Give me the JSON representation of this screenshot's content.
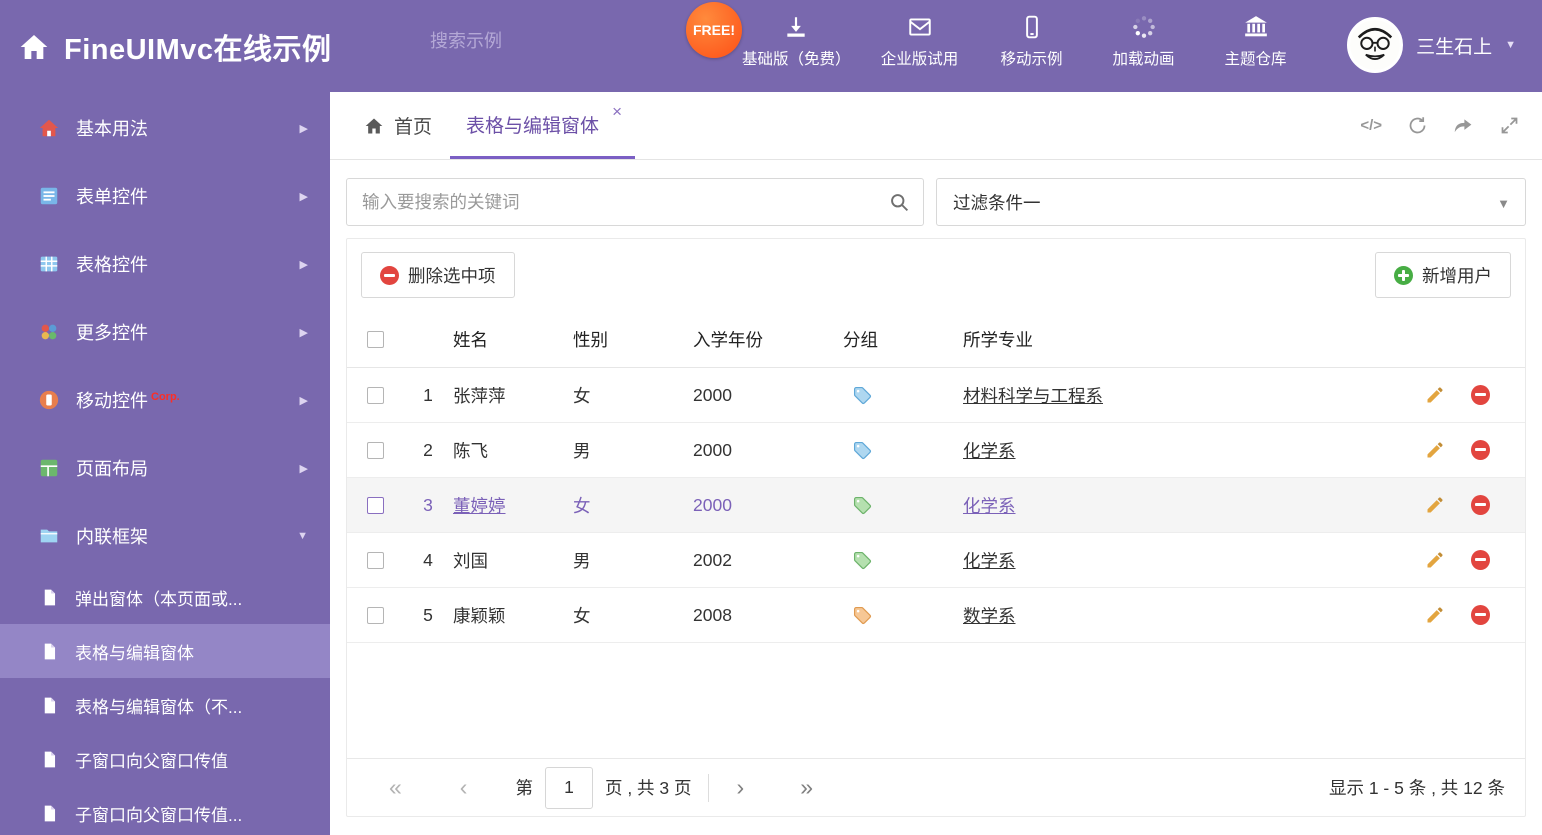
{
  "header": {
    "title": "FineUIMvc在线示例",
    "search_placeholder": "搜索示例",
    "free_badge": "FREE!",
    "nav_items": [
      {
        "label": "基础版（免费）"
      },
      {
        "label": "企业版试用"
      },
      {
        "label": "移动示例"
      },
      {
        "label": "加载动画"
      },
      {
        "label": "主题仓库"
      }
    ],
    "username": "三生石上"
  },
  "sidebar": {
    "items": [
      {
        "label": "基本用法"
      },
      {
        "label": "表单控件"
      },
      {
        "label": "表格控件"
      },
      {
        "label": "更多控件"
      },
      {
        "label": "移动控件",
        "badge": "Corp."
      },
      {
        "label": "页面布局"
      },
      {
        "label": "内联框架",
        "expanded": true
      }
    ],
    "subitems": [
      {
        "label": "弹出窗体（本页面或..."
      },
      {
        "label": "表格与编辑窗体",
        "active": true
      },
      {
        "label": "表格与编辑窗体（不..."
      },
      {
        "label": "子窗口向父窗口传值"
      },
      {
        "label": "子窗口向父窗口传值..."
      }
    ]
  },
  "tabs": {
    "home": "首页",
    "active": "表格与编辑窗体"
  },
  "filter": {
    "search_placeholder": "输入要搜索的关键词",
    "dropdown_value": "过滤条件一"
  },
  "toolbar": {
    "delete_label": "删除选中项",
    "add_label": "新增用户"
  },
  "table": {
    "headers": {
      "name": "姓名",
      "gender": "性别",
      "year": "入学年份",
      "group": "分组",
      "major": "所学专业"
    },
    "rows": [
      {
        "num": "1",
        "name": "张萍萍",
        "gender": "女",
        "year": "2000",
        "major": "材料科学与工程系",
        "tag_fill": "#aed7f0",
        "tag_stroke": "#5fa8d8"
      },
      {
        "num": "2",
        "name": "陈飞",
        "gender": "男",
        "year": "2000",
        "major": "化学系",
        "tag_fill": "#aed7f0",
        "tag_stroke": "#5fa8d8"
      },
      {
        "num": "3",
        "name": "董婷婷",
        "gender": "女",
        "year": "2000",
        "major": "化学系",
        "tag_fill": "#b5e0af",
        "tag_stroke": "#6db36b",
        "selected": true
      },
      {
        "num": "4",
        "name": "刘国",
        "gender": "男",
        "year": "2002",
        "major": "化学系",
        "tag_fill": "#b5e0af",
        "tag_stroke": "#6db36b"
      },
      {
        "num": "5",
        "name": "康颖颖",
        "gender": "女",
        "year": "2008",
        "major": "数学系",
        "tag_fill": "#f6c795",
        "tag_stroke": "#e09a50"
      }
    ]
  },
  "pagination": {
    "label_page": "第",
    "current_page": "1",
    "label_total": "页 , 共 3 页",
    "summary": "显示 1 - 5 条 , 共 12 条"
  },
  "icons": {
    "caret_down": "▼",
    "arrow_right": "▶",
    "tab_close": "×",
    "code": "</>",
    "page_first": "«",
    "page_prev": "‹",
    "page_next": "›",
    "page_last": "»"
  },
  "colors": {
    "theme_purple": "#7968ae",
    "active_purple": "#6c50a7",
    "selected_row_text": "#7b61b8",
    "free_orange": "#fd4f16",
    "corp_red": "#ff2d24"
  }
}
